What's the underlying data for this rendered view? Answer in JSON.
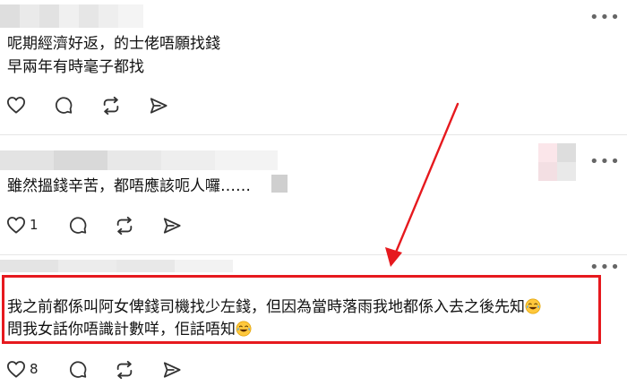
{
  "posts": [
    {
      "lines": [
        "呢期經濟好返，的士佬唔願找錢",
        "早兩年有時毫子都找"
      ],
      "like_count": "",
      "icons": [
        "heart-icon",
        "comment-icon",
        "repost-icon",
        "share-icon"
      ]
    },
    {
      "lines": [
        "雖然搵錢辛苦，都唔應該呃人囉……"
      ],
      "like_count": "1",
      "icons": [
        "heart-icon",
        "comment-icon",
        "repost-icon",
        "share-icon"
      ]
    },
    {
      "lines": [
        "我之前都係叫阿女俾錢司機找少左錢，但因為當時落雨我地都係入去之後先知",
        "問我女話你唔識計數咩，佢話唔知"
      ],
      "like_count": "8",
      "icons": [
        "heart-icon",
        "comment-icon",
        "repost-icon",
        "share-icon"
      ]
    }
  ],
  "more_label": "•••",
  "colors": {
    "highlight": "#e6191e",
    "icon": "#333333",
    "divider": "#e6e6e6"
  }
}
